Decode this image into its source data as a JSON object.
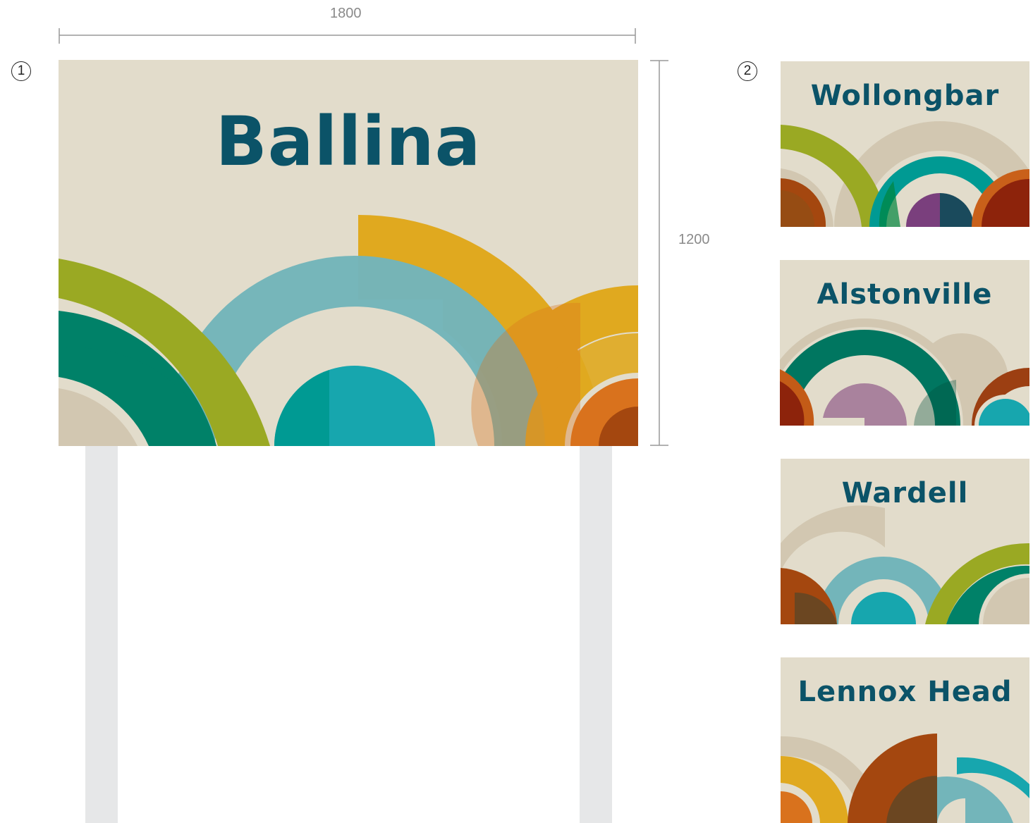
{
  "dimensions": {
    "width_label": "1800",
    "height_label": "1200"
  },
  "markers": {
    "main": "1",
    "variants": "2"
  },
  "main_sign": {
    "town": "Ballina"
  },
  "variant_signs": [
    {
      "town": "Wollongbar"
    },
    {
      "town": "Alstonville"
    },
    {
      "town": "Wardell"
    },
    {
      "town": "Lennox Head"
    }
  ],
  "colors": {
    "background": "#e2dccb",
    "title": "#0b5368",
    "olive": "#9aa923",
    "green": "#008168",
    "teal": "#009a93",
    "light_teal": "#73b5ba",
    "bright_teal": "#17a6ae",
    "gold": "#e0a91f",
    "orange": "#d9721d",
    "rust": "#a4470f",
    "dark_red": "#8d230b",
    "purple": "#7a3f7d",
    "lilac": "#a9829d",
    "navy": "#1a4a5c",
    "beige": "#d2c7b1",
    "post": "#e6e7e8"
  }
}
